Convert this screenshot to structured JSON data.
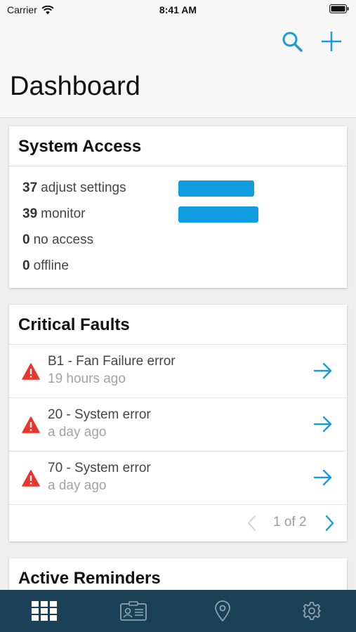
{
  "status_bar": {
    "carrier": "Carrier",
    "time": "8:41 AM"
  },
  "header": {
    "title": "Dashboard",
    "actions": [
      {
        "icon": "search-icon"
      },
      {
        "icon": "plus-icon"
      }
    ]
  },
  "colors": {
    "accent": "#1a9ad8",
    "bar": "#0f9ce0",
    "warning": "#e9352b",
    "tab_bar": "#1b4157",
    "tab_icon": "#8ea2b0",
    "tab_icon_active": "#ffffff"
  },
  "system_access": {
    "title": "System Access",
    "rows": [
      {
        "count": "37",
        "label": "adjust settings",
        "value": 37
      },
      {
        "count": "39",
        "label": "monitor",
        "value": 39
      },
      {
        "count": "0",
        "label": "no access",
        "value": 0
      },
      {
        "count": "0",
        "label": "offline",
        "value": 0
      }
    ]
  },
  "critical_faults": {
    "title": "Critical Faults",
    "items": [
      {
        "title": "B1 - Fan Failure error",
        "time": "19 hours ago"
      },
      {
        "title": "20 - System error",
        "time": "a day ago"
      },
      {
        "title": "70 - System error",
        "time": "a day ago"
      }
    ],
    "pager": "1 of 2"
  },
  "active_reminders": {
    "title": "Active Reminders"
  },
  "tab_bar": {
    "tabs": [
      {
        "icon": "grid-icon",
        "active": true
      },
      {
        "icon": "contact-card-icon",
        "active": false
      },
      {
        "icon": "location-pin-icon",
        "active": false
      },
      {
        "icon": "gear-icon",
        "active": false
      }
    ]
  }
}
